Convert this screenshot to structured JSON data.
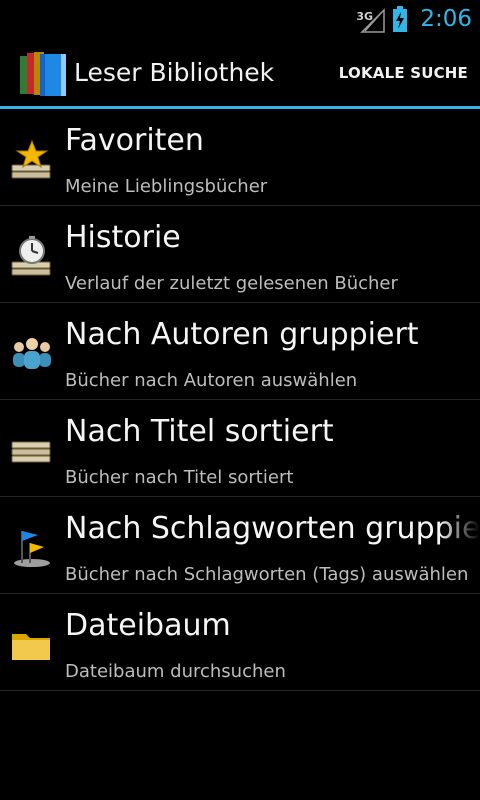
{
  "status_bar": {
    "network": "3G",
    "time": "2:06",
    "icons": [
      "signal-icon",
      "battery-charging-icon"
    ]
  },
  "action_bar": {
    "title": "Leser Bibliothek",
    "button_label": "LOKALE SUCHE",
    "accent_color": "#33b5e5"
  },
  "items": [
    {
      "title": "Favoriten",
      "subtitle": "Meine Lieblingsbücher",
      "icon": "star-books-icon"
    },
    {
      "title": "Historie",
      "subtitle": "Verlauf der zuletzt gelesenen Bücher",
      "icon": "clock-books-icon"
    },
    {
      "title": "Nach Autoren gruppiert",
      "subtitle": "Bücher nach Autoren auswählen",
      "icon": "people-icon"
    },
    {
      "title": "Nach Titel sortiert",
      "subtitle": "Bücher nach Titel sortiert",
      "icon": "books-stack-icon"
    },
    {
      "title": "Nach Schlagworten gruppiert",
      "subtitle": "Bücher nach Schlagworten (Tags) auswählen",
      "icon": "flags-icon"
    },
    {
      "title": "Dateibaum",
      "subtitle": "Dateibaum durchsuchen",
      "icon": "folder-icon"
    }
  ]
}
